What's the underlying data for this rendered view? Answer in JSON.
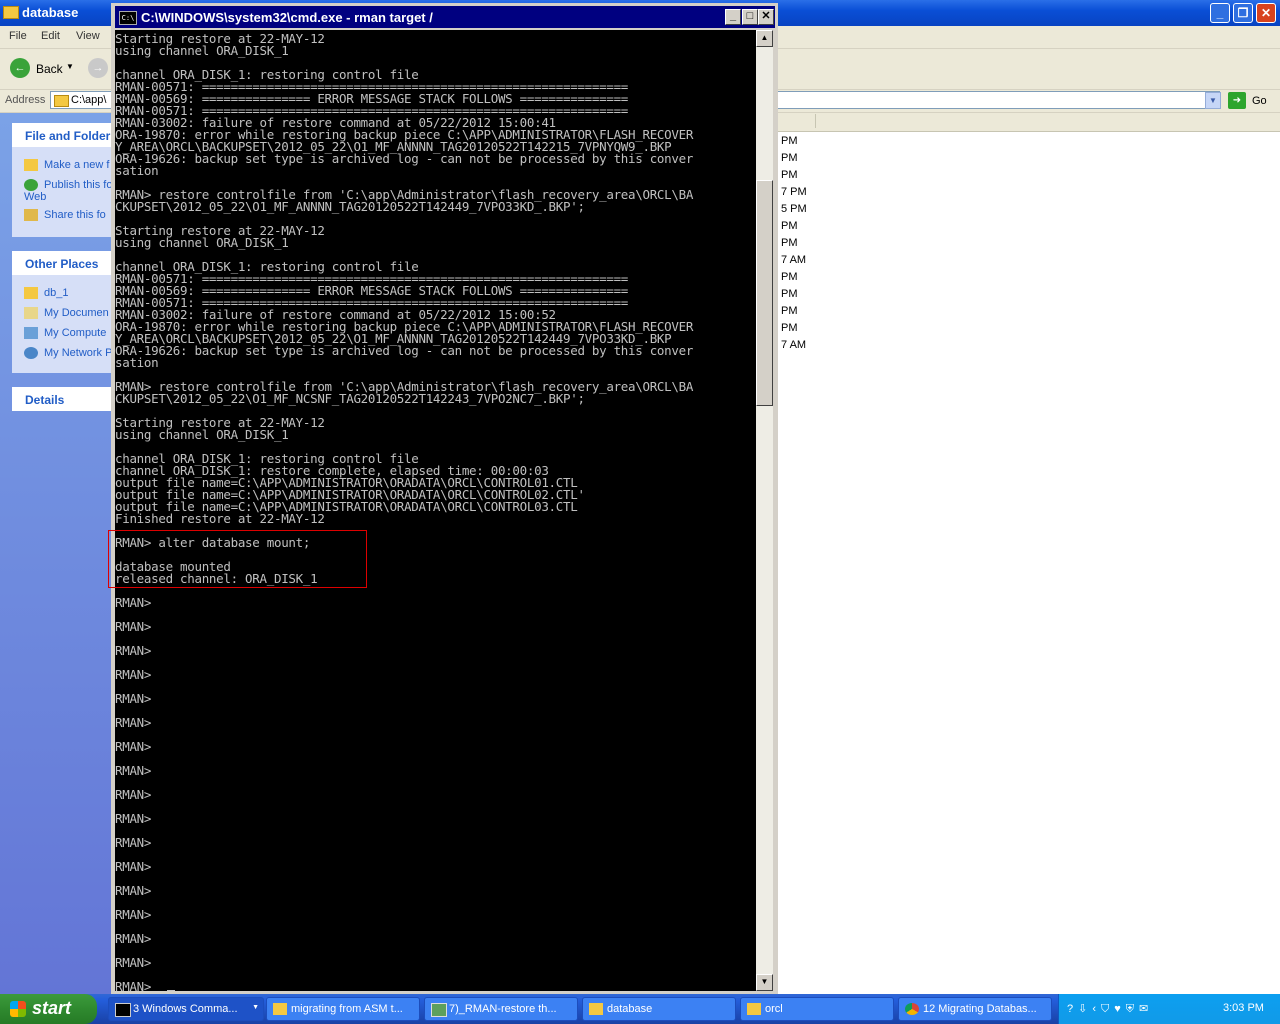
{
  "explorer": {
    "title": "database",
    "menu": [
      "File",
      "Edit",
      "View"
    ],
    "back_label": "Back",
    "address_label": "Address",
    "address_value": "C:\\app\\",
    "go_label": "Go",
    "file_folder_tasks": {
      "title": "File and Folder",
      "items": [
        "Make a new f",
        "Publish this fo\nWeb",
        "Share this fo"
      ]
    },
    "other_places": {
      "title": "Other Places",
      "items": [
        "db_1",
        "My Documen",
        "My Compute",
        "My Network P"
      ]
    },
    "details_title": "Details",
    "file_times": [
      "PM",
      "PM",
      "PM",
      "7 PM",
      "5 PM",
      "PM",
      "PM",
      "7 AM",
      "PM",
      "PM",
      "PM",
      "PM",
      "7 AM"
    ]
  },
  "cmd": {
    "title": "C:\\WINDOWS\\system32\\cmd.exe - rman target /",
    "icon_text": "C:\\",
    "console": "Starting restore at 22-MAY-12\nusing channel ORA_DISK_1\n\nchannel ORA_DISK_1: restoring control file\nRMAN-00571: ===========================================================\nRMAN-00569: =============== ERROR MESSAGE STACK FOLLOWS ===============\nRMAN-00571: ===========================================================\nRMAN-03002: failure of restore command at 05/22/2012 15:00:41\nORA-19870: error while restoring backup piece C:\\APP\\ADMINISTRATOR\\FLASH_RECOVER\nY_AREA\\ORCL\\BACKUPSET\\2012_05_22\\O1_MF_ANNNN_TAG20120522T142215_7VPNYQW9_.BKP\nORA-19626: backup set type is archived log - can not be processed by this conver\nsation\n\nRMAN> restore controlfile from 'C:\\app\\Administrator\\flash_recovery_area\\ORCL\\BA\nCKUPSET\\2012_05_22\\O1_MF_ANNNN_TAG20120522T142449_7VPO33KD_.BKP';\n\nStarting restore at 22-MAY-12\nusing channel ORA_DISK_1\n\nchannel ORA_DISK_1: restoring control file\nRMAN-00571: ===========================================================\nRMAN-00569: =============== ERROR MESSAGE STACK FOLLOWS ===============\nRMAN-00571: ===========================================================\nRMAN-03002: failure of restore command at 05/22/2012 15:00:52\nORA-19870: error while restoring backup piece C:\\APP\\ADMINISTRATOR\\FLASH_RECOVER\nY_AREA\\ORCL\\BACKUPSET\\2012_05_22\\O1_MF_ANNNN_TAG20120522T142449_7VPO33KD_.BKP\nORA-19626: backup set type is archived log - can not be processed by this conver\nsation\n\nRMAN> restore controlfile from 'C:\\app\\Administrator\\flash_recovery_area\\ORCL\\BA\nCKUPSET\\2012_05_22\\O1_MF_NCSNF_TAG20120522T142243_7VPO2NC7_.BKP';\n\nStarting restore at 22-MAY-12\nusing channel ORA_DISK_1\n\nchannel ORA_DISK_1: restoring control file\nchannel ORA_DISK_1: restore complete, elapsed time: 00:00:03\noutput file name=C:\\APP\\ADMINISTRATOR\\ORADATA\\ORCL\\CONTROL01.CTL\noutput file name=C:\\APP\\ADMINISTRATOR\\ORADATA\\ORCL\\CONTROL02.CTL'\noutput file name=C:\\APP\\ADMINISTRATOR\\ORADATA\\ORCL\\CONTROL03.CTL\nFinished restore at 22-MAY-12\n\nRMAN> alter database mount;\n\ndatabase mounted\nreleased channel: ORA_DISK_1\n\nRMAN>\n\nRMAN>\n\nRMAN>\n\nRMAN>\n\nRMAN>\n\nRMAN>\n\nRMAN>\n\nRMAN>\n\nRMAN>\n\nRMAN>\n\nRMAN>\n\nRMAN>\n\nRMAN>\n\nRMAN>\n\nRMAN>\n\nRMAN>\n\nRMAN> "
  },
  "taskbar": {
    "start_label": "start",
    "tasks": [
      {
        "label": "3 Windows Comma...",
        "icon": "cmd-icon"
      },
      {
        "label": "migrating from ASM t...",
        "icon": "folder-icon"
      },
      {
        "label": "7)_RMAN-restore th...",
        "icon": "image-icon"
      },
      {
        "label": "database",
        "icon": "folder-icon"
      },
      {
        "label": "orcl",
        "icon": "folder-icon"
      },
      {
        "label": "12 Migrating Databas...",
        "icon": "chrome-icon"
      }
    ],
    "clock": "3:03 PM"
  },
  "colors": {
    "xp_blue": "#0a4fd6",
    "console_bg": "#000000",
    "console_fg": "#c0c0c0",
    "highlight": "#dd0000"
  }
}
